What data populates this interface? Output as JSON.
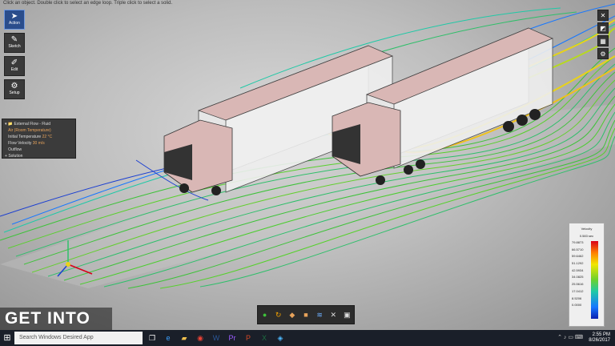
{
  "viewport": {
    "hint": "Click an object. Double click to select an edge loop. Triple click to select a solid."
  },
  "left_toolbar": [
    {
      "label": "Action",
      "icon": "cursor-icon"
    },
    {
      "label": "Sketch",
      "icon": "pencil-icon"
    },
    {
      "label": "Edit",
      "icon": "edit-icon"
    },
    {
      "label": "Setup",
      "icon": "setup-icon"
    }
  ],
  "tree": {
    "root": "External Flow - Fluid",
    "items": [
      "Air (Room Temperature)",
      "Initial Temperature",
      "Flow Velocity",
      "Outflow"
    ],
    "initial_temperature_value": "22 °C",
    "flow_velocity_value": "30 m/s",
    "solution": "Solution"
  },
  "right_toolbar": [
    {
      "icon": "close-icon"
    },
    {
      "icon": "camera-icon"
    },
    {
      "icon": "grid-icon"
    },
    {
      "icon": "gear-icon"
    }
  ],
  "legend": {
    "title": "Velocity",
    "subtitle": "0.583 sec",
    "ticks": [
      "79.8873",
      "66.5710",
      "59.6462",
      "51.1292",
      "42.5934",
      "34.0825",
      "25.5616",
      "17.0412",
      "8.5206",
      "0.0000"
    ]
  },
  "bottom_toolbar": [
    {
      "icon": "particle-icon"
    },
    {
      "icon": "rotate-icon"
    },
    {
      "icon": "cube-icon"
    },
    {
      "icon": "box-icon"
    },
    {
      "icon": "streamline-icon"
    },
    {
      "icon": "mesh-icon"
    },
    {
      "icon": "surface-icon"
    }
  ],
  "watermark": "GET INTO PC",
  "taskbar": {
    "search_placeholder": "Search Windows Desired App",
    "time": "2:55 PM",
    "date": "8/26/2017"
  },
  "colors": {
    "accent": "#2a4d8c",
    "streamline_green": "#3ec23a",
    "streamline_blue": "#1b3fd1",
    "streamline_yellow": "#e8d21a",
    "trailer_pink": "#d9b7b5"
  }
}
